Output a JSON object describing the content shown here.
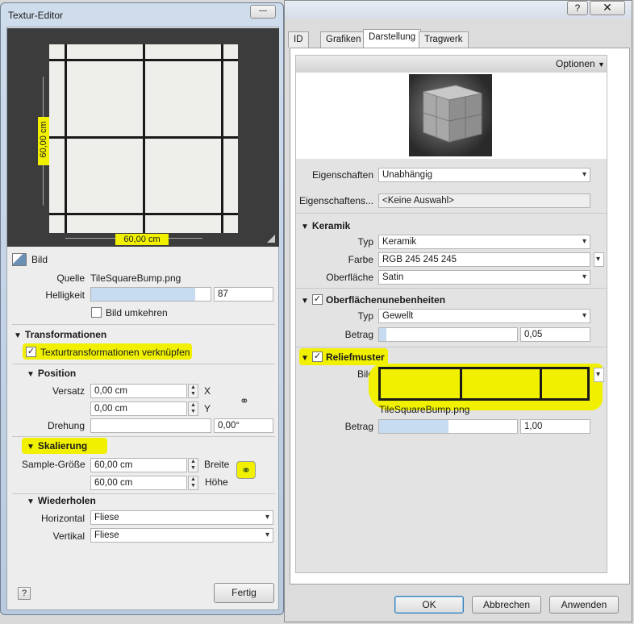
{
  "texture_editor": {
    "title": "Textur-Editor",
    "dimension_vertical": "60,00 cm",
    "dimension_horizontal": "60,00 cm",
    "image_section_label": "Bild",
    "source_label": "Quelle",
    "source_value": "TileSquareBump.png",
    "brightness_label": "Helligkeit",
    "brightness_value": "87",
    "brightness_level": 0.87,
    "invert_label": "Bild umkehren",
    "transformations_header": "Transformationen",
    "link_transforms_label": "Texturtransformationen verknüpfen",
    "position_header": "Position",
    "offset_label": "Versatz",
    "offset_x": "0,00 cm",
    "offset_y": "0,00 cm",
    "x_label": "X",
    "y_label": "Y",
    "rotation_label": "Drehung",
    "rotation_value": "0,00°",
    "scaling_header": "Skalierung",
    "sample_size_label": "Sample-Größe",
    "sample_width": "60,00 cm",
    "sample_height": "60,00 cm",
    "width_label": "Breite",
    "height_label": "Höhe",
    "repeat_header": "Wiederholen",
    "horizontal_label": "Horizontal",
    "horizontal_value": "Fliese",
    "vertical_label": "Vertikal",
    "vertical_value": "Fliese",
    "help_label": "?",
    "done_label": "Fertig",
    "minimize_label": "—"
  },
  "material_dialog": {
    "help_label": "?",
    "tabs": [
      "ID",
      "Grafiken",
      "Darstellung",
      "Tragwerk"
    ],
    "options_label": "Optionen",
    "properties_label": "Eigenschaften",
    "properties_value": "Unabhängig",
    "property_set_label": "Eigenschaftens...",
    "property_set_value": "<Keine Auswahl>",
    "ceramic_header": "Keramik",
    "type_label": "Typ",
    "type_value": "Keramik",
    "color_label": "Farbe",
    "color_value": "RGB 245 245 245",
    "surface_label": "Oberfläche",
    "surface_value": "Satin",
    "bumps_header": "Oberflächenunebenheiten",
    "bumps_type_label": "Typ",
    "bumps_type_value": "Gewellt",
    "bumps_amount_label": "Betrag",
    "bumps_amount_value": "0,05",
    "bumps_amount_level": 0.05,
    "relief_header": "Reliefmuster",
    "relief_image_label": "Bild",
    "relief_filename": "TileSquareBump.png",
    "relief_amount_label": "Betrag",
    "relief_amount_value": "1,00",
    "relief_amount_level": 0.5,
    "ok_label": "OK",
    "cancel_label": "Abbrechen",
    "apply_label": "Anwenden"
  },
  "colors": {
    "highlight": "#f0f000",
    "preview_bg": "#3c3c3c",
    "tile": "#eeeeea"
  }
}
